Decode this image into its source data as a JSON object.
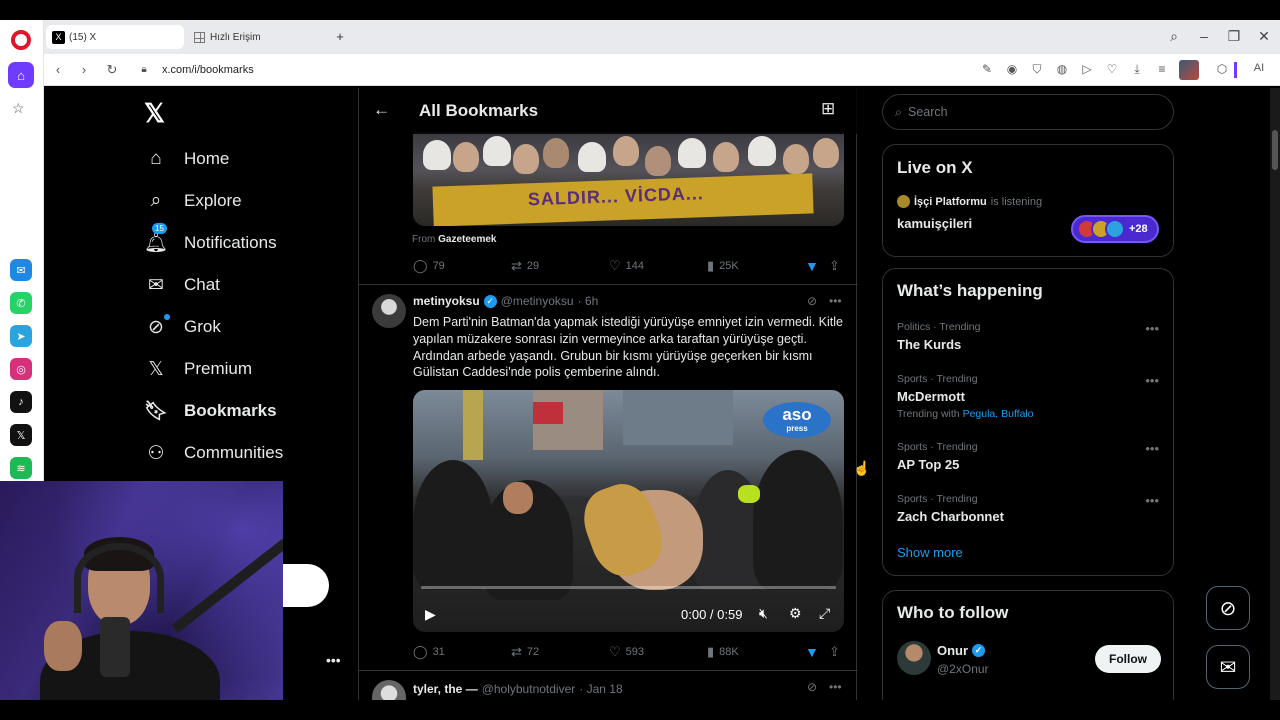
{
  "browser": {
    "tabs": [
      {
        "label": "(15) X",
        "favicon": "x-logo"
      },
      {
        "label": "Hızlı Erişim",
        "favicon": "grid-icon"
      }
    ],
    "url": "x.com/i/bookmarks",
    "ai_label": "AI"
  },
  "nav": {
    "items": [
      {
        "label": "Home",
        "icon": "home-icon"
      },
      {
        "label": "Explore",
        "icon": "search-icon"
      },
      {
        "label": "Notifications",
        "icon": "bell-icon",
        "badge": "15"
      },
      {
        "label": "Chat",
        "icon": "mail-icon"
      },
      {
        "label": "Grok",
        "icon": "grok-icon"
      },
      {
        "label": "Premium",
        "icon": "x-icon"
      },
      {
        "label": "Bookmarks",
        "icon": "bookmark-icon",
        "active": true
      },
      {
        "label": "Communities",
        "icon": "people-icon"
      }
    ]
  },
  "main": {
    "title": "All Bookmarks",
    "tweet1": {
      "image_banner_text": "SALDIR... VİCDA...",
      "from_label": "From",
      "from_source": "Gazeteemek",
      "replies": "79",
      "retweets": "29",
      "likes": "144",
      "views": "25K"
    },
    "tweet2": {
      "name": "metinyoksu",
      "handle": "@metinyoksu",
      "time": "· 6h",
      "text": "Dem Parti'nin Batman'da yapmak istediği yürüyüşe emniyet izin vermedi. Kitle yapılan müzakere sonrası izin vermeyince arka taraftan yürüyüşe geçti. Ardından arbede yaşandı. Grubun bir kısmı yürüyüşe geçerken bir kısmı Gülistan Caddesi'nde polis çemberine alındı.",
      "video_logo": "aso",
      "video_logo_sub": "press",
      "video_time": "0:00 / 0:59",
      "replies": "31",
      "retweets": "72",
      "likes": "593",
      "views": "88K"
    },
    "tweet3": {
      "name": "tyler, the —",
      "handle": "@holybutnotdiver",
      "time": "· Jan 18"
    }
  },
  "right": {
    "search_placeholder": "Search",
    "live": {
      "title": "Live on X",
      "host": "İşçi Platformu",
      "status": "is listening",
      "topic": "kamuişçileri",
      "listeners_more": "+28"
    },
    "happening": {
      "title": "What’s happening",
      "trends": [
        {
          "category": "Politics · Trending",
          "name": "The Kurds"
        },
        {
          "category": "Sports · Trending",
          "name": "McDermott",
          "sub_prefix": "Trending with",
          "sub_links": "Pegula, Buffalo"
        },
        {
          "category": "Sports · Trending",
          "name": "AP Top 25"
        },
        {
          "category": "Sports · Trending",
          "name": "Zach Charbonnet"
        }
      ],
      "show_more": "Show more"
    },
    "who_to_follow": {
      "title": "Who to follow",
      "name": "Onur",
      "handle": "@2xOnur",
      "button": "Follow"
    }
  },
  "colors": {
    "accent": "#1d9bf0",
    "background": "#000000",
    "border": "#2f3336",
    "secondary_text": "#71767b"
  }
}
